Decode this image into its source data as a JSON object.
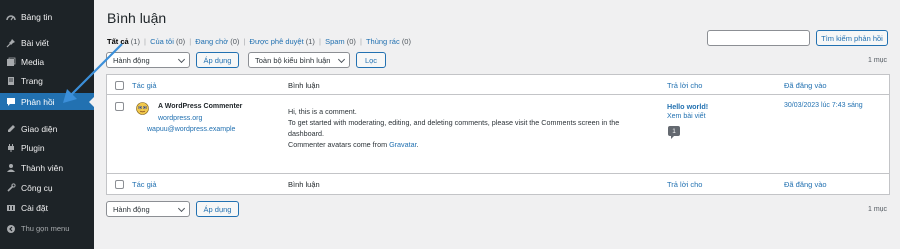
{
  "sidebar": {
    "items": [
      {
        "label": "Bảng tin",
        "icon": "dashboard-icon"
      },
      {
        "label": "Bài viết",
        "icon": "pin-icon"
      },
      {
        "label": "Media",
        "icon": "media-icon"
      },
      {
        "label": "Trang",
        "icon": "page-icon"
      },
      {
        "label": "Phản hồi",
        "icon": "comments-icon"
      },
      {
        "label": "Giao diện",
        "icon": "appearance-icon"
      },
      {
        "label": "Plugin",
        "icon": "plugin-icon"
      },
      {
        "label": "Thành viên",
        "icon": "users-icon"
      },
      {
        "label": "Công cụ",
        "icon": "tools-icon"
      },
      {
        "label": "Cài đặt",
        "icon": "settings-icon"
      }
    ],
    "collapse_label": "Thu gọn menu"
  },
  "page": {
    "title": "Bình luận",
    "filters": [
      {
        "label": "Tất cả",
        "count": "(1)"
      },
      {
        "label": "Của tôi",
        "count": "(0)"
      },
      {
        "label": "Đang chờ",
        "count": "(0)"
      },
      {
        "label": "Được phê duyệt",
        "count": "(1)"
      },
      {
        "label": "Spam",
        "count": "(0)"
      },
      {
        "label": "Thùng rác",
        "count": "(0)"
      }
    ],
    "search_button": "Tìm kiếm phản hồi",
    "bulk_action": "Hành động",
    "apply": "Áp dụng",
    "comment_type": "Toàn bộ kiểu bình luận",
    "filter_button": "Lọc",
    "items_count": "1 mục"
  },
  "table": {
    "columns": {
      "author": "Tác giả",
      "comment": "Bình luận",
      "response": "Trả lời cho",
      "date": "Đã đăng vào"
    },
    "row": {
      "author_name": "A WordPress Commenter",
      "author_url": "wordpress.org",
      "author_email": "wapuu@wordpress.example",
      "comment_line1": "Hi, this is a comment.",
      "comment_line2": "To get started with moderating, editing, and deleting comments, please visit the Comments screen in the",
      "comment_line3": "dashboard.",
      "comment_line4_prefix": "Commenter avatars come from ",
      "comment_link": "Gravatar",
      "comment_line4_suffix": ".",
      "response_title": "Hello world!",
      "response_view": "Xem bài viết",
      "response_count": "1",
      "date": "30/03/2023 lúc 7:43 sáng"
    }
  },
  "colors": {
    "accent": "#2271b1",
    "sidebar_bg": "#1d2327",
    "page_bg": "#f0f0f1",
    "annotation": "#3b8fd9"
  }
}
